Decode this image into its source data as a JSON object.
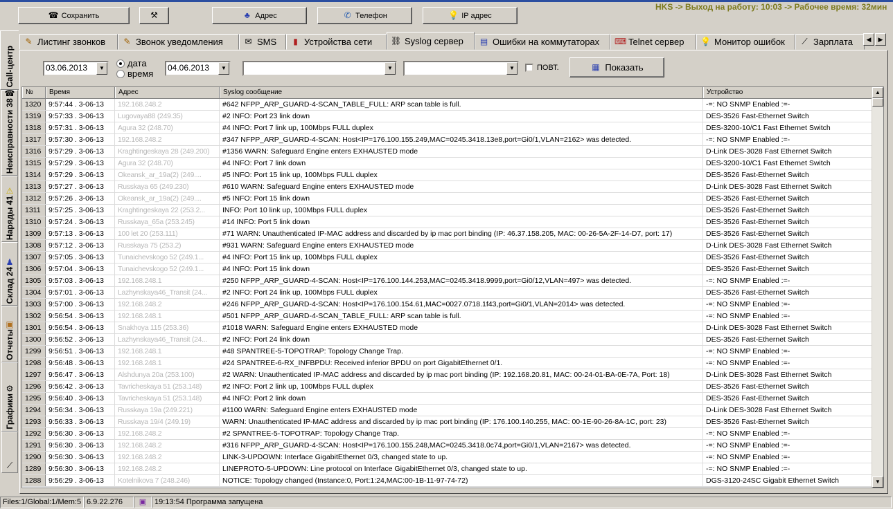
{
  "toolbar": {
    "save": "Сохранить",
    "address": "Адрес",
    "phone": "Телефон",
    "ip_address": "IP адрес"
  },
  "top_status": "HKS -> Выход на работу: 10:03 -> Рабочее время: 32мин",
  "side_tabs": [
    "Call-центр",
    "Неисправности 38",
    "Наряды 41",
    "Склад 24",
    "Отчеты",
    "Графики"
  ],
  "tabs": [
    "Листинг звонков",
    "Звонок уведомления",
    "SMS",
    "Устройства сети",
    "Syslog сервер",
    "Ошибки на коммутаторах",
    "Telnet сервер",
    "Монитор ошибок",
    "Зарплата"
  ],
  "active_tab": "Syslog сервер",
  "filters": {
    "date_from": "03.06.2013",
    "date_to": "04.06.2013",
    "radio_date": "дата",
    "radio_time": "время",
    "combo1": "",
    "combo2": "",
    "repeat_label": "ПОВТ.",
    "show_button": "Показать"
  },
  "table": {
    "columns": [
      "№",
      "Время",
      "Адрес",
      "Syslog сообщение",
      "Устройство"
    ],
    "rows": [
      [
        "1320",
        "9:57:44 . 3-06-13",
        "192.168.248.2",
        "#642 NFPP_ARP_GUARD-4-SCAN_TABLE_FULL: ARP scan table is full.",
        "-=: NO SNMP Enabled :=-"
      ],
      [
        "1319",
        "9:57:33 . 3-06-13",
        "Lugovaya88 (249.35)",
        "#2  INFO: Port 23 link down",
        "DES-3526 Fast-Ethernet Switch"
      ],
      [
        "1318",
        "9:57:31 . 3-06-13",
        "Agura 32 (248.70)",
        "#4  INFO: Port 7 link up, 100Mbps FULL duplex",
        "DES-3200-10/C1 Fast Ethernet Switch"
      ],
      [
        "1317",
        "9:57:30 . 3-06-13",
        "192.168.248.2",
        "#347 NFPP_ARP_GUARD-4-SCAN: Host<IP=176.100.155.249,MAC=0245.3418.13e8,port=Gi0/1,VLAN=2162> was detected.",
        "-=: NO SNMP Enabled :=-"
      ],
      [
        "1316",
        "9:57:29 . 3-06-13",
        "Kraghtingeskaya 28 (249.200)",
        "#1356  WARN: Safeguard Engine enters EXHAUSTED mode",
        "D-Link DES-3028 Fast Ethernet Switch"
      ],
      [
        "1315",
        "9:57:29 . 3-06-13",
        "Agura 32 (248.70)",
        "#4  INFO: Port 7 link down",
        "DES-3200-10/C1 Fast Ethernet Switch"
      ],
      [
        "1314",
        "9:57:29 . 3-06-13",
        "Okeansk_ar_19a(2) (249....",
        "#5  INFO: Port 15 link up, 100Mbps FULL duplex",
        "DES-3526 Fast-Ethernet Switch"
      ],
      [
        "1313",
        "9:57:27 . 3-06-13",
        "Russkaya 65 (249.230)",
        "#610  WARN: Safeguard Engine enters EXHAUSTED mode",
        "D-Link DES-3028 Fast Ethernet Switch"
      ],
      [
        "1312",
        "9:57:26 . 3-06-13",
        "Okeansk_ar_19a(2) (249....",
        "#5  INFO: Port 15 link down",
        "DES-3526 Fast-Ethernet Switch"
      ],
      [
        "1311",
        "9:57:25 . 3-06-13",
        "Kraghtingeskaya 22 (253.2...",
        "  INFO: Port 10 link up, 100Mbps FULL duplex",
        "DES-3526 Fast-Ethernet Switch"
      ],
      [
        "1310",
        "9:57:24 . 3-06-13",
        "Russkaya_65a (253.245)",
        "#14  INFO: Port 5 link down",
        "DES-3526 Fast-Ethernet Switch"
      ],
      [
        "1309",
        "9:57:13 . 3-06-13",
        "100 let 20 (253.111)",
        "#71  WARN: Unauthenticated IP-MAC address and discarded by ip mac port binding (IP: 46.37.158.205, MAC: 00-26-5A-2F-14-D7, port: 17)",
        "DES-3526 Fast-Ethernet Switch"
      ],
      [
        "1308",
        "9:57:12 . 3-06-13",
        "Russkaya 75 (253.2)",
        "#931  WARN: Safeguard Engine enters EXHAUSTED mode",
        "D-Link DES-3028 Fast Ethernet Switch"
      ],
      [
        "1307",
        "9:57:05 . 3-06-13",
        "Tunaichevskogo 52 (249.1...",
        "#4  INFO: Port 15 link up, 100Mbps FULL duplex",
        "DES-3526 Fast-Ethernet Switch"
      ],
      [
        "1306",
        "9:57:04 . 3-06-13",
        "Tunaichevskogo 52 (249.1...",
        "#4  INFO: Port 15 link down",
        "DES-3526 Fast-Ethernet Switch"
      ],
      [
        "1305",
        "9:57:03 . 3-06-13",
        "192.168.248.1",
        "#250 NFPP_ARP_GUARD-4-SCAN: Host<IP=176.100.144.253,MAC=0245.3418.9999,port=Gi0/12,VLAN=497> was detected.",
        "-=: NO SNMP Enabled :=-"
      ],
      [
        "1304",
        "9:57:01 . 3-06-13",
        "Lazhynskaya46_Transit (24...",
        "#2  INFO: Port 24 link up, 100Mbps FULL duplex",
        "DES-3526 Fast-Ethernet Switch"
      ],
      [
        "1303",
        "9:57:00 . 3-06-13",
        "192.168.248.2",
        "#246 NFPP_ARP_GUARD-4-SCAN: Host<IP=176.100.154.61,MAC=0027.0718.1f43,port=Gi0/1,VLAN=2014> was detected.",
        "-=: NO SNMP Enabled :=-"
      ],
      [
        "1302",
        "9:56:54 . 3-06-13",
        "192.168.248.1",
        "#501 NFPP_ARP_GUARD-4-SCAN_TABLE_FULL: ARP scan table is full.",
        "-=: NO SNMP Enabled :=-"
      ],
      [
        "1301",
        "9:56:54 . 3-06-13",
        "Snakhoya 115 (253.36)",
        "#1018  WARN: Safeguard Engine enters EXHAUSTED mode",
        "D-Link DES-3028 Fast Ethernet Switch"
      ],
      [
        "1300",
        "9:56:52 . 3-06-13",
        "Lazhynskaya46_Transit (24...",
        "#2  INFO: Port 24 link down",
        "DES-3526 Fast-Ethernet Switch"
      ],
      [
        "1299",
        "9:56:51 . 3-06-13",
        "192.168.248.1",
        "#48 SPANTREE-5-TOPOTRAP: Topology Change Trap.",
        "-=: NO SNMP Enabled :=-"
      ],
      [
        "1298",
        "9:56:48 . 3-06-13",
        "192.168.248.1",
        "#24 SPANTREE-6-RX_INFBPDU: Received inferior BPDU on port GigabitEthernet 0/1.",
        "-=: NO SNMP Enabled :=-"
      ],
      [
        "1297",
        "9:56:47 . 3-06-13",
        "Alshdunya 20a (253.100)",
        "#2  WARN: Unauthenticated IP-MAC address and discarded by ip mac port binding (IP: 192.168.20.81, MAC: 00-24-01-BA-0E-7A, Port: 18)",
        "D-Link DES-3028 Fast Ethernet Switch"
      ],
      [
        "1296",
        "9:56:42 . 3-06-13",
        "Tavricheskaya 51 (253.148)",
        "#2  INFO: Port 2 link up, 100Mbps FULL duplex",
        "DES-3526 Fast-Ethernet Switch"
      ],
      [
        "1295",
        "9:56:40 . 3-06-13",
        "Tavricheskaya 51 (253.148)",
        "#4  INFO: Port 2 link down",
        "DES-3526 Fast-Ethernet Switch"
      ],
      [
        "1294",
        "9:56:34 . 3-06-13",
        "Russkaya 19a (249.221)",
        "#1100  WARN: Safeguard Engine enters EXHAUSTED mode",
        "D-Link DES-3028 Fast Ethernet Switch"
      ],
      [
        "1293",
        "9:56:33 . 3-06-13",
        "Russkaya 19/4 (249.19)",
        "  WARN: Unauthenticated IP-MAC address and discarded by ip mac port binding (IP: 176.100.140.255, MAC: 00-1E-90-26-8A-1C, port: 23)",
        "DES-3526 Fast-Ethernet Switch"
      ],
      [
        "1292",
        "9:56:30 . 3-06-13",
        "192.168.248.2",
        "#2 SPANTREE-5-TOPOTRAP: Topology Change Trap.",
        "-=: NO SNMP Enabled :=-"
      ],
      [
        "1291",
        "9:56:30 . 3-06-13",
        "192.168.248.2",
        "#316 NFPP_ARP_GUARD-4-SCAN: Host<IP=176.100.155.248,MAC=0245.3418.0c74,port=Gi0/1,VLAN=2167> was detected.",
        "-=: NO SNMP Enabled :=-"
      ],
      [
        "1290",
        "9:56:30 . 3-06-13",
        "192.168.248.2",
        "LINK-3-UPDOWN: Interface GigabitEthernet 0/3, changed state to up.",
        "-=: NO SNMP Enabled :=-"
      ],
      [
        "1289",
        "9:56:30 . 3-06-13",
        "192.168.248.2",
        "LINEPROTO-5-UPDOWN: Line protocol on Interface GigabitEthernet 0/3, changed state to up.",
        "-=: NO SNMP Enabled :=-"
      ],
      [
        "1288",
        "9:56:29 . 3-06-13",
        "Kotelnikova 7 (248.246)",
        "  NOTICE: Topology changed (Instance:0, Port:1:24,MAC:00-1B-11-97-74-72)",
        "DGS-3120-24SC Gigabit Ethernet Switch"
      ]
    ]
  },
  "statusbar": {
    "files": "Files:1/Global:1/Mem:5",
    "version": "6.9.22.276",
    "message": "19:13:54 Программа запущена"
  }
}
